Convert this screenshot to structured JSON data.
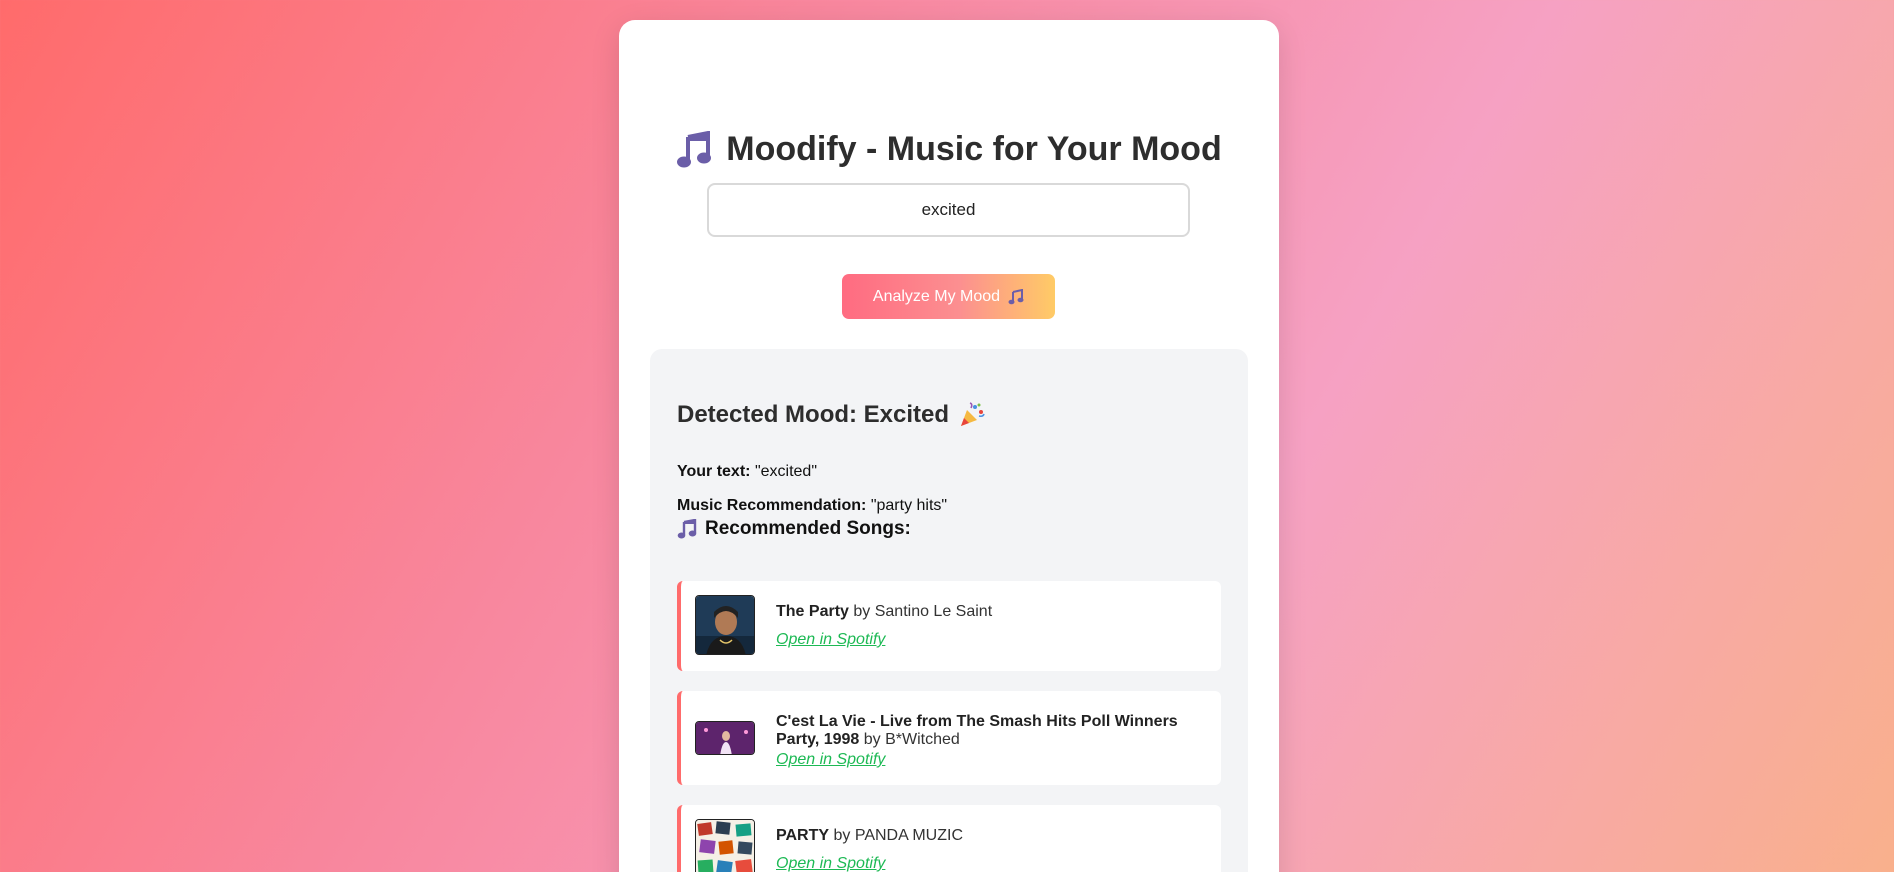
{
  "app": {
    "title": "Moodify - Music for Your Mood",
    "title_icon": "music-note-icon"
  },
  "search": {
    "value": "excited",
    "placeholder": ""
  },
  "analyze_button": {
    "label": "Analyze My Mood",
    "icon": "music-notes-icon"
  },
  "result": {
    "mood_heading": "Detected Mood: Excited",
    "mood_icon": "party-popper-icon",
    "your_text_label": "Your text:",
    "your_text_value": "\"excited\"",
    "recommendation_label": "Music Recommendation:",
    "recommendation_value": "\"party hits\"",
    "songs_heading": "Recommended Songs:",
    "songs": [
      {
        "title": "The Party",
        "by": "by Santino Le Saint",
        "link_label": "Open in Spotify"
      },
      {
        "title": "C'est La Vie - Live from The Smash Hits Poll Winners Party, 1998",
        "by": "by B*Witched",
        "link_label": "Open in Spotify"
      },
      {
        "title": "PARTY",
        "by": "by PANDA MUZIC",
        "link_label": "Open in Spotify"
      }
    ]
  },
  "colors": {
    "accent": "#ff6b6b",
    "link": "#1db954",
    "note_icon": "#6b5ea8"
  }
}
